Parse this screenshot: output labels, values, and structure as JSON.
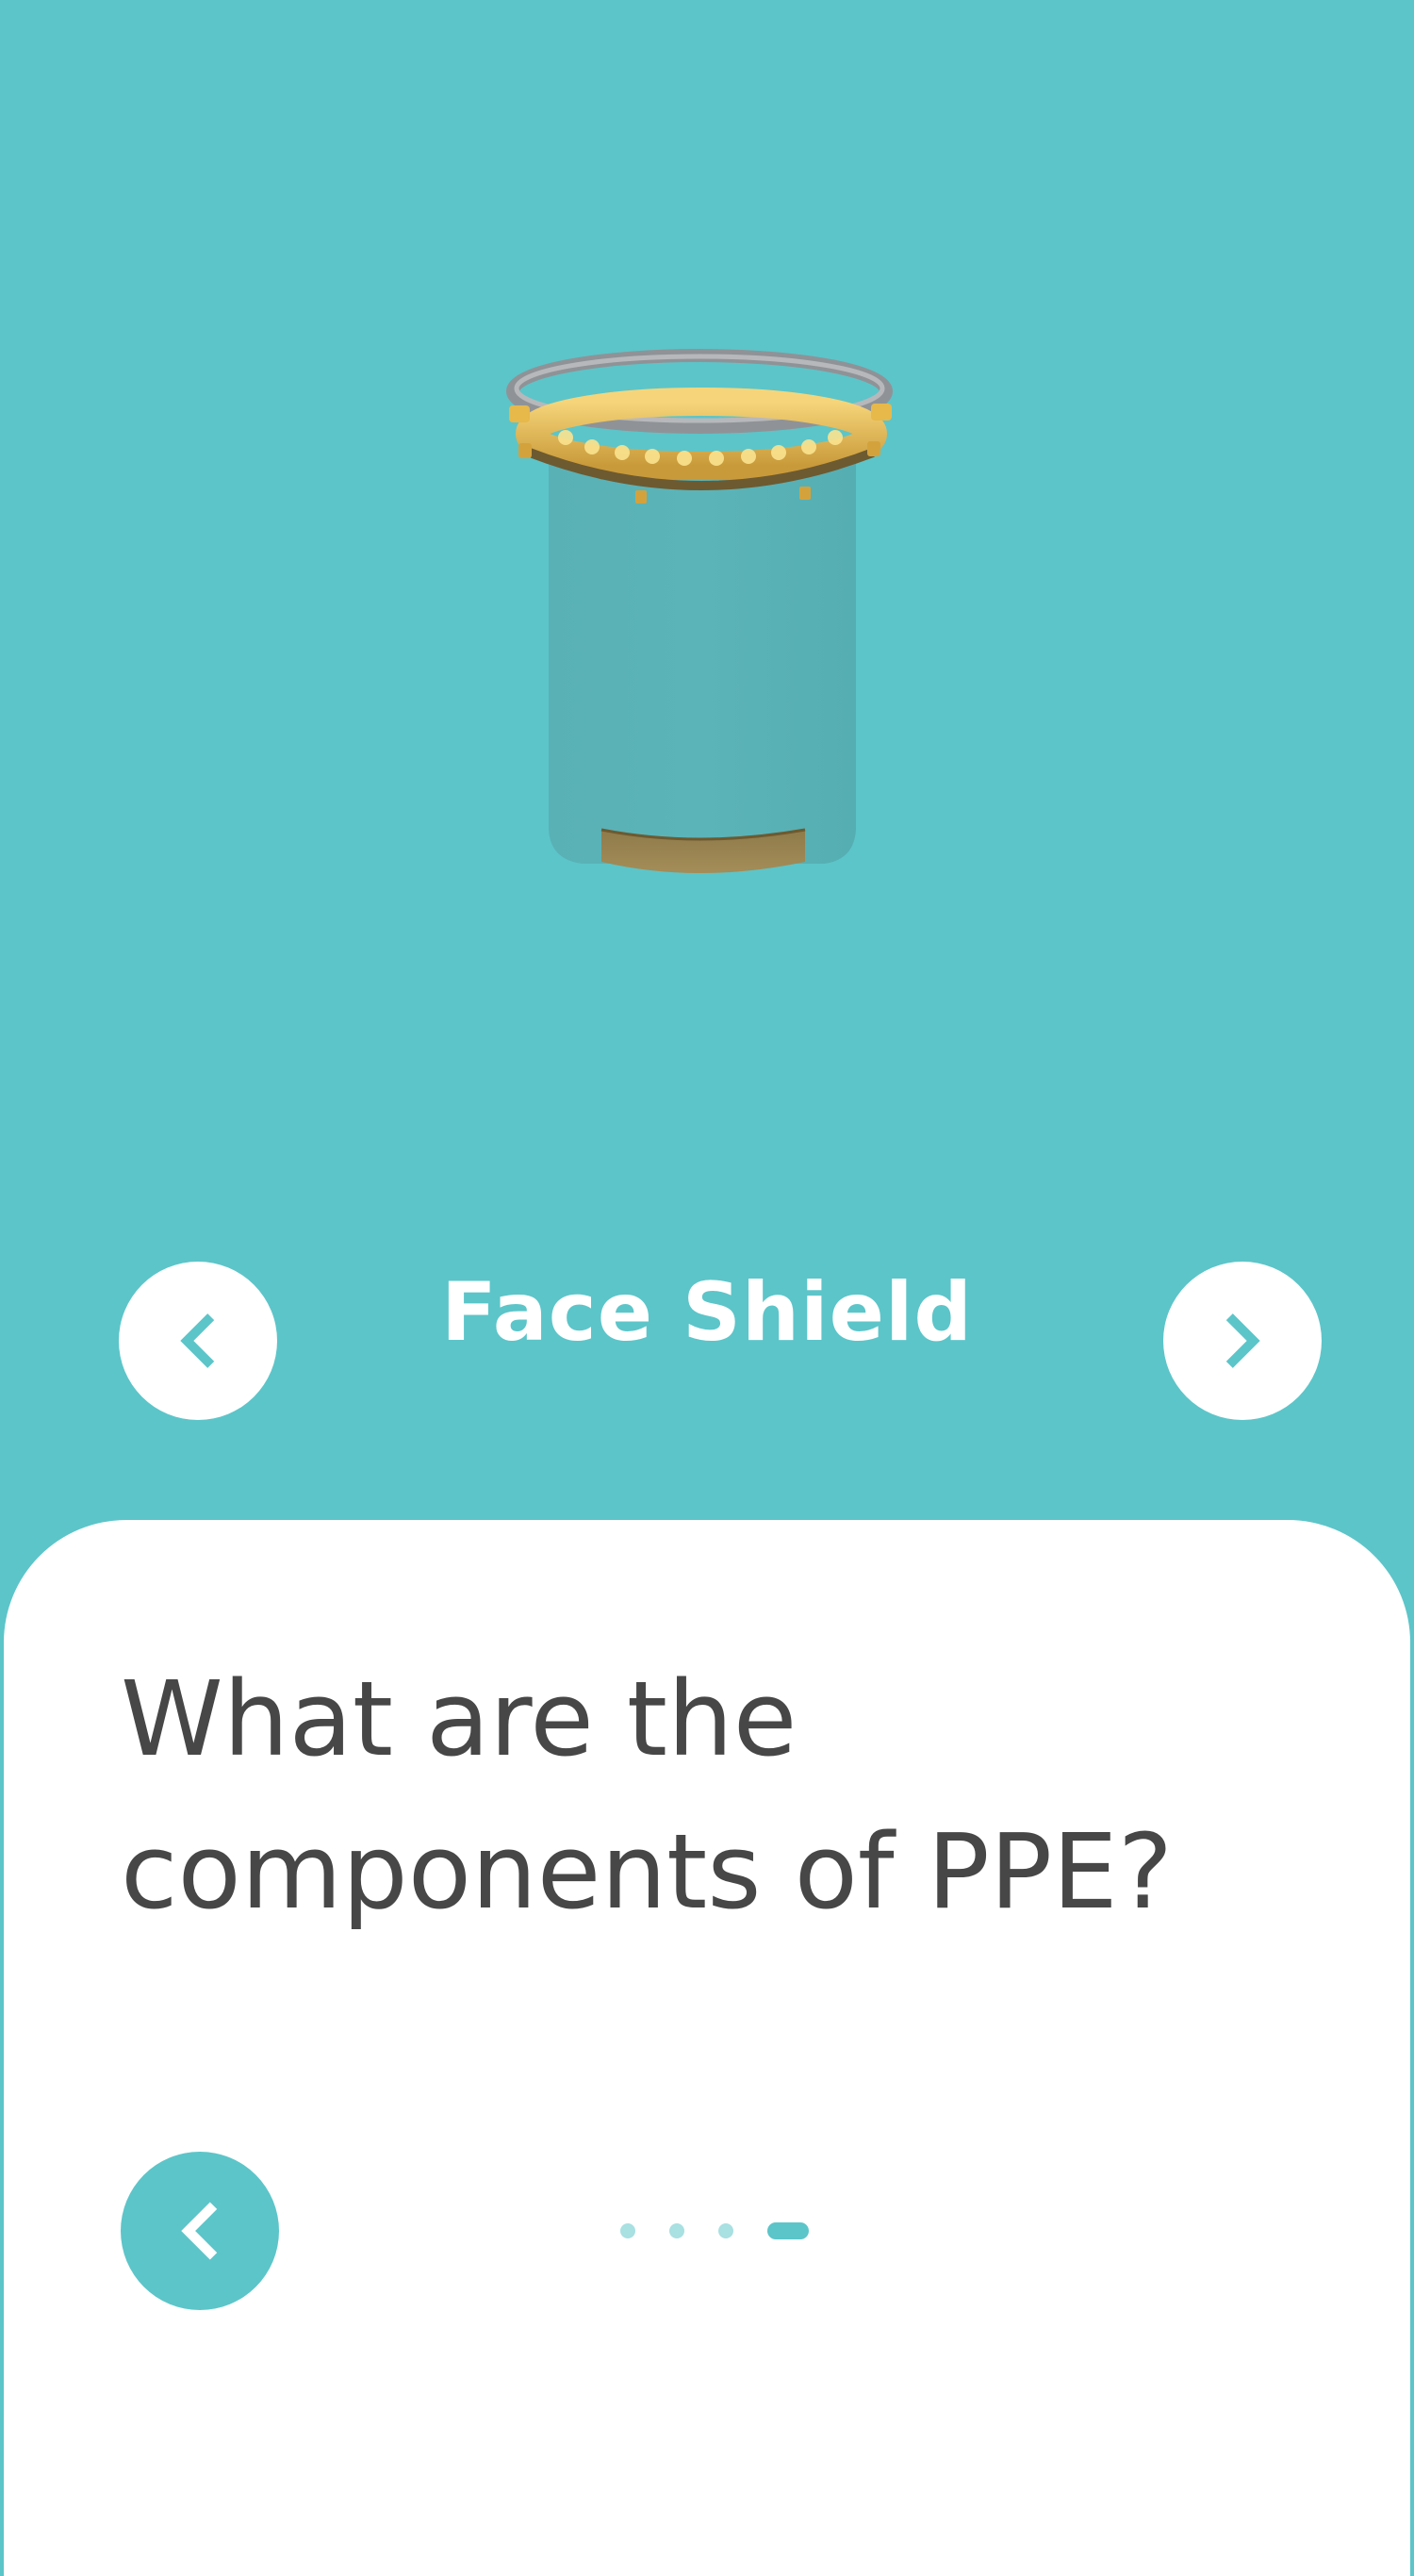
{
  "colors": {
    "background": "#5cc5c9",
    "card": "#ffffff",
    "accent": "#5cc5c9",
    "question_text": "#474747",
    "dot_inactive": "#a9e0e2"
  },
  "model": {
    "icon": "face-shield-3d-model"
  },
  "carousel": {
    "title": "Face Shield",
    "prev_icon": "chevron-left-icon",
    "next_icon": "chevron-right-icon"
  },
  "card": {
    "question": "What are the components of PPE?",
    "back_icon": "chevron-left-icon",
    "pagination": {
      "total": 4,
      "current": 4
    }
  }
}
